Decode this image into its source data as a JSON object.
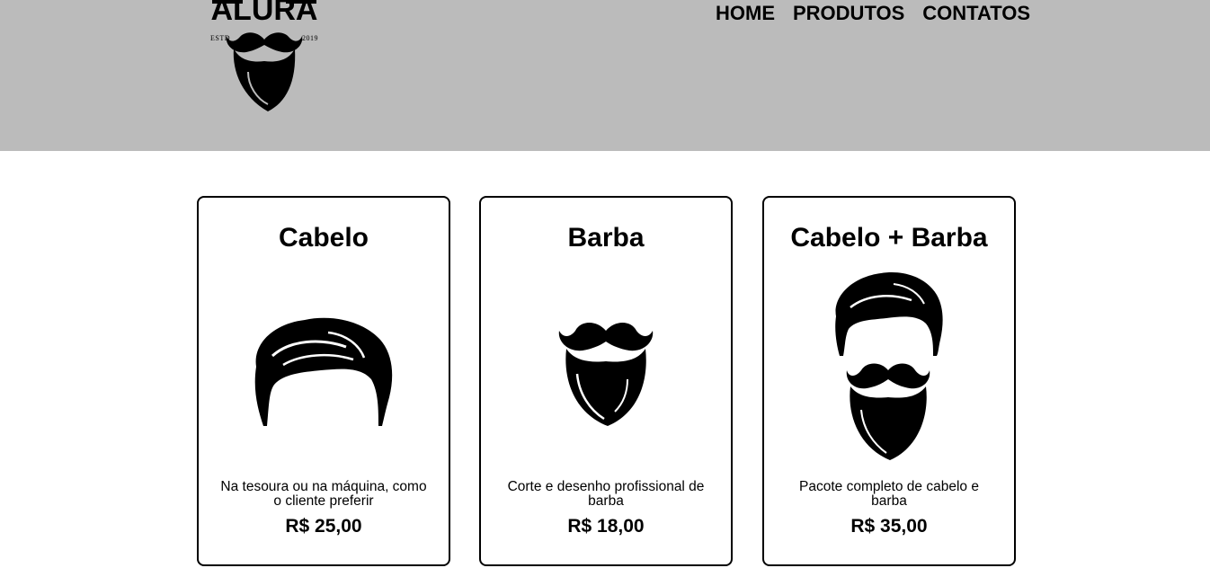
{
  "header": {
    "logo": {
      "name": "ALURA",
      "estd": "ESTD",
      "year": "2019"
    },
    "nav": [
      {
        "label": "HOME"
      },
      {
        "label": "PRODUTOS"
      },
      {
        "label": "CONTATOS"
      }
    ],
    "background_color": "#bbbbbb"
  },
  "products": [
    {
      "title": "Cabelo",
      "icon": "hair-icon",
      "description": "Na tesoura ou na máquina, como o cliente preferir",
      "price": "R$ 25,00"
    },
    {
      "title": "Barba",
      "icon": "beard-icon",
      "description": "Corte e desenho profissional de barba",
      "price": "R$ 18,00"
    },
    {
      "title": "Cabelo + Barba",
      "icon": "hair-and-beard-icon",
      "description": "Pacote completo de cabelo e barba",
      "price": "R$ 35,00"
    }
  ]
}
